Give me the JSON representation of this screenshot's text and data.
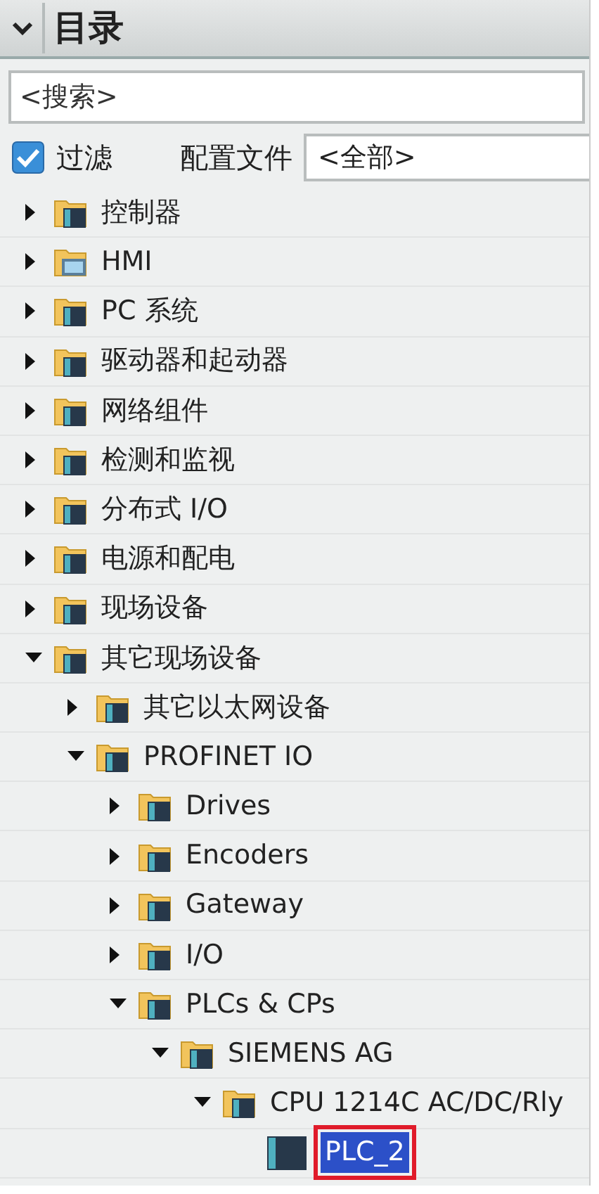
{
  "panel": {
    "title": "目录",
    "expanded": true
  },
  "search": {
    "placeholder": "<搜索>"
  },
  "filter": {
    "label": "过滤",
    "checked": true
  },
  "profile": {
    "label": "配置文件",
    "value": "<全部>"
  },
  "tree": [
    {
      "label": "控制器",
      "kind": "folder",
      "expanded": false,
      "selected": false
    },
    {
      "label": "HMI",
      "kind": "hmi-folder",
      "expanded": false,
      "selected": false
    },
    {
      "label": "PC 系统",
      "kind": "folder",
      "expanded": false,
      "selected": false
    },
    {
      "label": "驱动器和起动器",
      "kind": "folder",
      "expanded": false,
      "selected": false
    },
    {
      "label": "网络组件",
      "kind": "folder",
      "expanded": false,
      "selected": false
    },
    {
      "label": "检测和监视",
      "kind": "folder",
      "expanded": false,
      "selected": false
    },
    {
      "label": "分布式 I/O",
      "kind": "folder",
      "expanded": false,
      "selected": false
    },
    {
      "label": "电源和配电",
      "kind": "folder",
      "expanded": false,
      "selected": false
    },
    {
      "label": "现场设备",
      "kind": "folder",
      "expanded": false,
      "selected": false
    },
    {
      "label": "其它现场设备",
      "kind": "folder",
      "expanded": true,
      "selected": false,
      "children": [
        {
          "label": "其它以太网设备",
          "kind": "folder",
          "expanded": false,
          "selected": false
        },
        {
          "label": "PROFINET IO",
          "kind": "folder",
          "expanded": true,
          "selected": false,
          "children": [
            {
              "label": "Drives",
              "kind": "folder",
              "expanded": false,
              "selected": false
            },
            {
              "label": "Encoders",
              "kind": "folder",
              "expanded": false,
              "selected": false
            },
            {
              "label": "Gateway",
              "kind": "folder",
              "expanded": false,
              "selected": false
            },
            {
              "label": "I/O",
              "kind": "folder",
              "expanded": false,
              "selected": false
            },
            {
              "label": "PLCs & CPs",
              "kind": "folder",
              "expanded": true,
              "selected": false,
              "children": [
                {
                  "label": "SIEMENS AG",
                  "kind": "folder",
                  "expanded": true,
                  "selected": false,
                  "children": [
                    {
                      "label": "CPU 1214C AC/DC/Rly",
                      "kind": "folder",
                      "expanded": true,
                      "selected": false,
                      "children": [
                        {
                          "label": "PLC_2",
                          "kind": "device",
                          "selected": true
                        }
                      ]
                    }
                  ]
                }
              ]
            }
          ]
        }
      ]
    }
  ]
}
